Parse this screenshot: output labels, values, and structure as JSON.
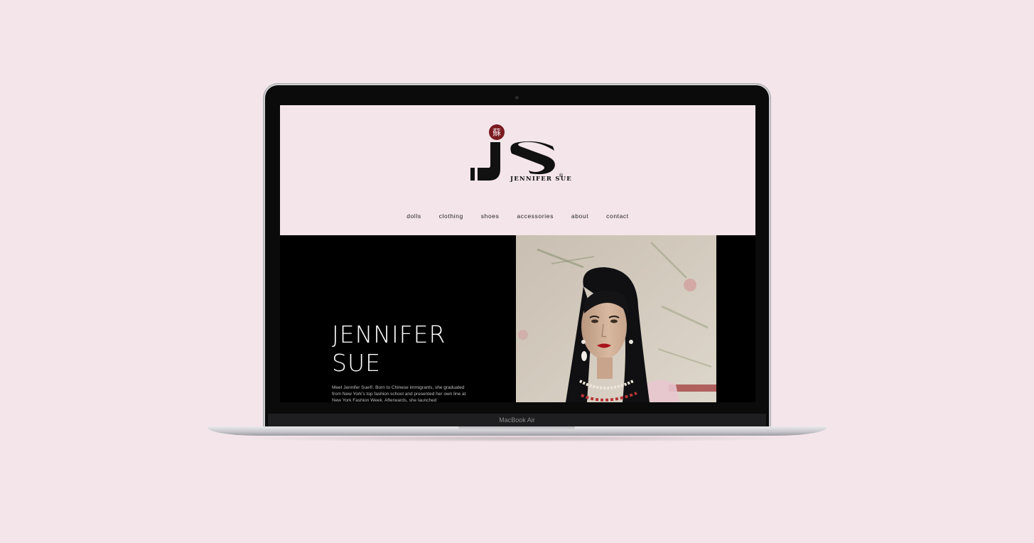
{
  "site": {
    "logo_icon": "js-monogram-logo",
    "brand_wordmark": "JENNIFER SUE",
    "registered_mark": "®",
    "seal_glyph": "蘇"
  },
  "nav": {
    "items": [
      {
        "label": "dolls"
      },
      {
        "label": "clothing"
      },
      {
        "label": "shoes"
      },
      {
        "label": "accessories"
      },
      {
        "label": "about"
      },
      {
        "label": "contact"
      }
    ]
  },
  "hero": {
    "title_line1": "JENNIFER",
    "title_line2": "SUE",
    "body": "Meet Jennifer Sue®. Born to Chinese immigrants, she graduated from New York's top fashion school and presented her own line at New York Fashion Week. Afterwards, she launched",
    "photo_icon": "doll-portrait-photo"
  },
  "device": {
    "label": "MacBook Air"
  },
  "colors": {
    "background": "#f4e5ea",
    "header_bg": "#f4e5ea",
    "hero_bg": "#000000",
    "seal_red": "#7a1a1f"
  }
}
